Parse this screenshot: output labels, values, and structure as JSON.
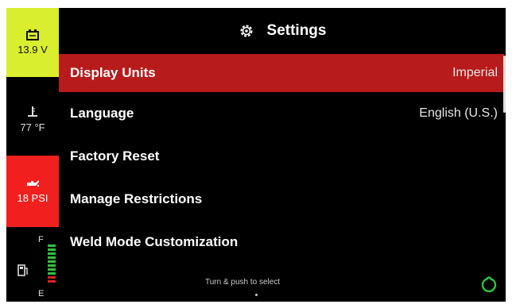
{
  "status": {
    "battery": {
      "icon": "battery-icon",
      "value": "13.9 V",
      "color": "#d9ee2e"
    },
    "temperature": {
      "icon": "thermometer-icon",
      "value": "77 °F"
    },
    "oil_pressure": {
      "icon": "oil-can-icon",
      "value": "18 PSI",
      "color": "#f21f1f"
    },
    "fuel": {
      "icon": "fuel-pump-icon",
      "full_label": "F",
      "empty_label": "E",
      "level": 0.75
    }
  },
  "header": {
    "icon": "gear-icon",
    "title": "Settings"
  },
  "menu": {
    "items": [
      {
        "label": "Display Units",
        "value": "Imperial",
        "selected": true
      },
      {
        "label": "Language",
        "value": "English (U.S.)",
        "selected": false
      },
      {
        "label": "Factory Reset",
        "value": "",
        "selected": false
      },
      {
        "label": "Manage Restrictions",
        "value": "",
        "selected": false
      },
      {
        "label": "Weld Mode Customization",
        "value": "",
        "selected": false
      }
    ]
  },
  "footer": {
    "hint": "Turn & push to select",
    "power_icon": "power-icon",
    "power_color": "#2fc43a"
  },
  "colors": {
    "selected_row": "#b81b1b",
    "background": "#000000"
  }
}
